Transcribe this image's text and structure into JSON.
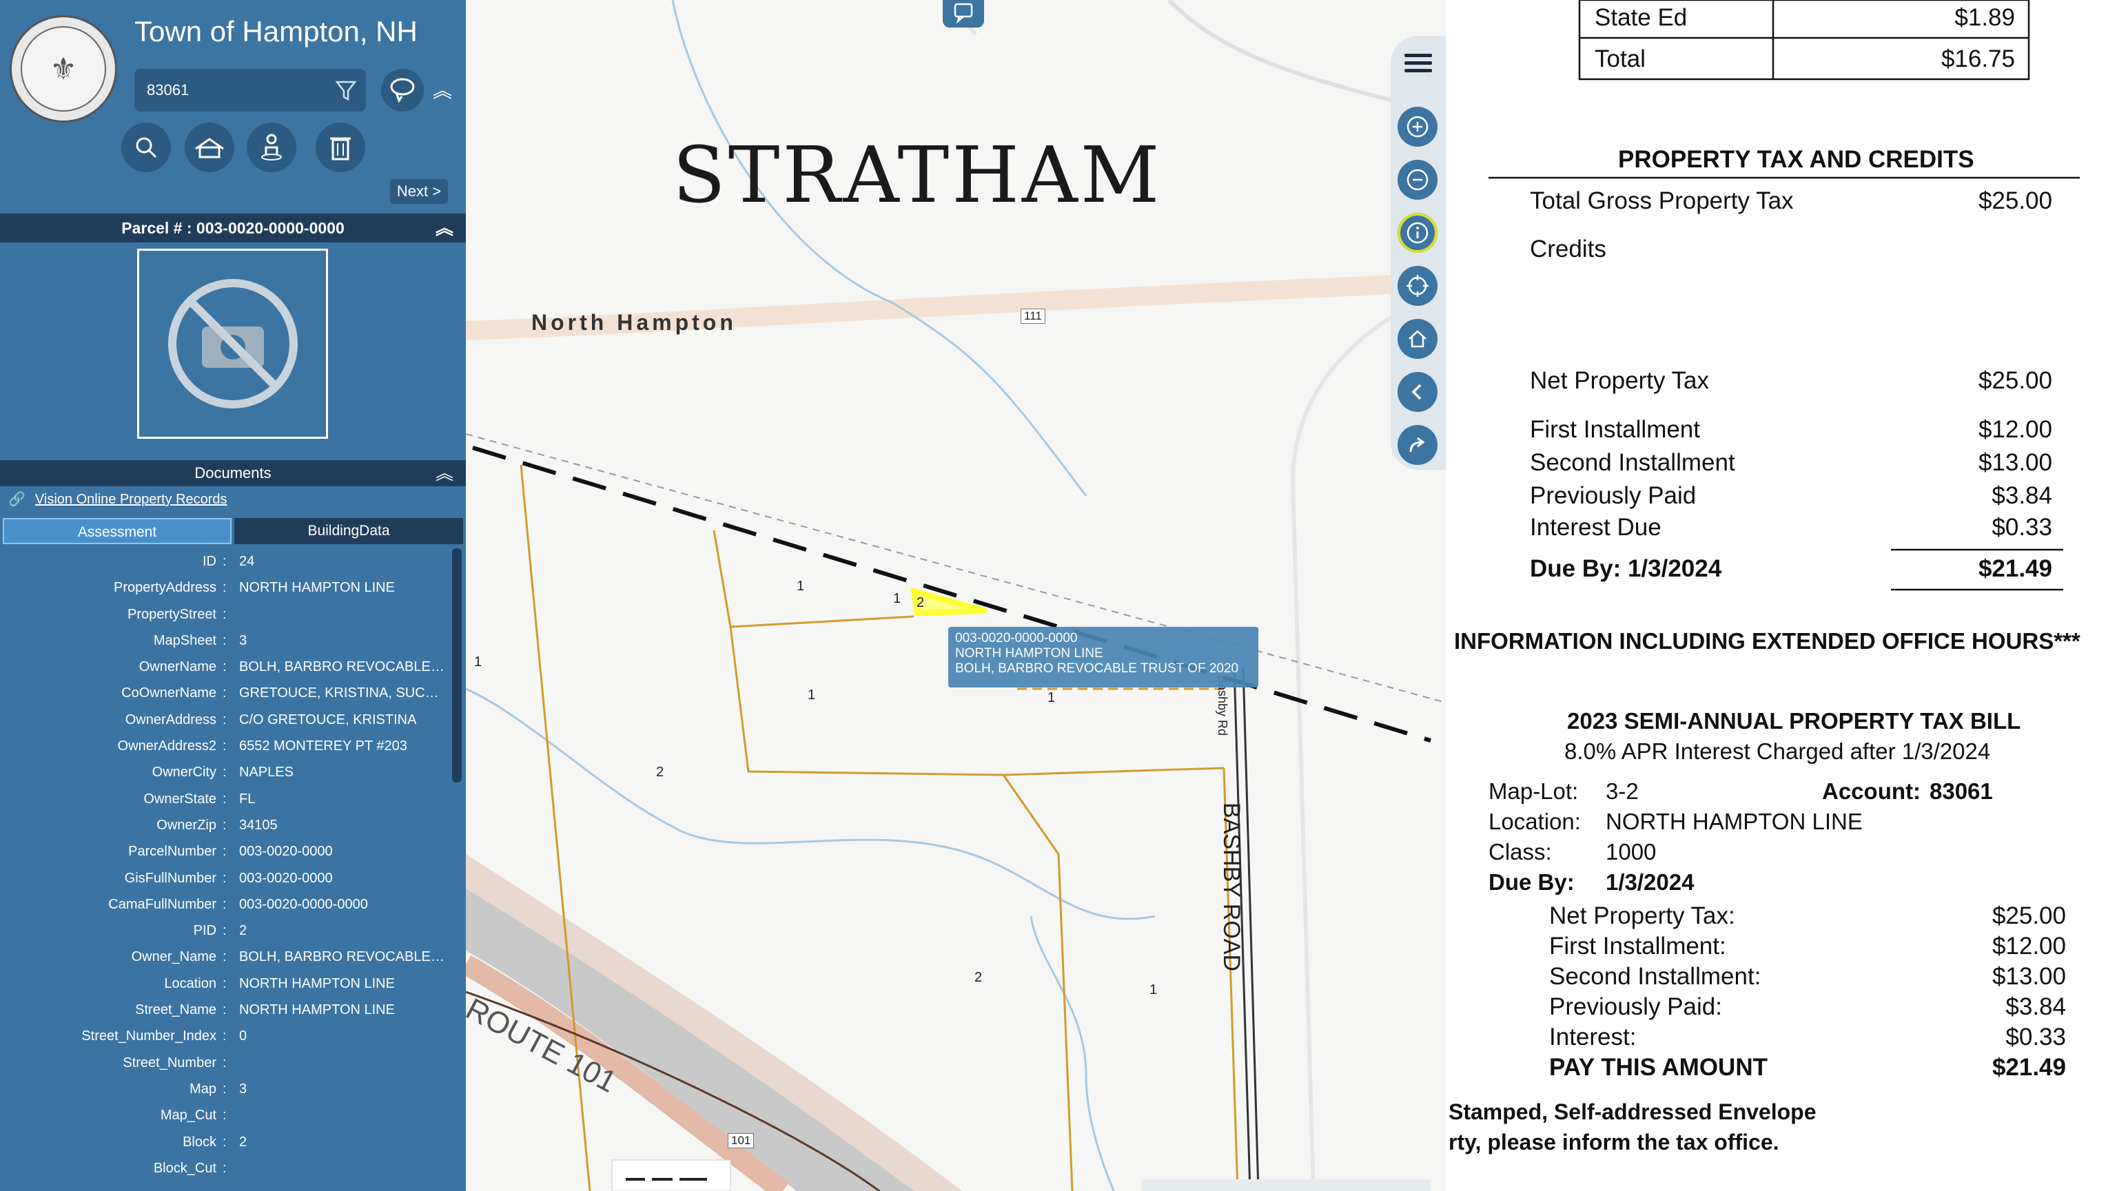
{
  "header": {
    "town_title": "Town of Hampton, NH",
    "search_value": "83061",
    "next_label": "Next >"
  },
  "parcel": {
    "title": "Parcel # : 003-0020-0000-0000"
  },
  "documents": {
    "title": "Documents",
    "link_label": "Vision Online Property Records"
  },
  "tabs": {
    "assessment": "Assessment",
    "building": "BuildingData"
  },
  "fields": [
    {
      "k": "ID",
      "v": "24"
    },
    {
      "k": "PropertyAddress",
      "v": "NORTH HAMPTON LINE"
    },
    {
      "k": "PropertyStreet",
      "v": ""
    },
    {
      "k": "MapSheet",
      "v": "3"
    },
    {
      "k": "OwnerName",
      "v": "BOLH, BARBRO REVOCABLE T..."
    },
    {
      "k": "CoOwnerName",
      "v": "GRETOUCE, KRISTINA, SUCC T..."
    },
    {
      "k": "OwnerAddress",
      "v": "C/O GRETOUCE, KRISTINA"
    },
    {
      "k": "OwnerAddress2",
      "v": "6552 MONTEREY PT #203"
    },
    {
      "k": "OwnerCity",
      "v": "NAPLES"
    },
    {
      "k": "OwnerState",
      "v": "FL"
    },
    {
      "k": "OwnerZip",
      "v": "34105"
    },
    {
      "k": "ParcelNumber",
      "v": "003-0020-0000"
    },
    {
      "k": "GisFullNumber",
      "v": "003-0020-0000"
    },
    {
      "k": "CamaFullNumber",
      "v": "003-0020-0000-0000"
    },
    {
      "k": "PID",
      "v": "2"
    },
    {
      "k": "Owner_Name",
      "v": "BOLH, BARBRO REVOCABLE T..."
    },
    {
      "k": "Location",
      "v": "NORTH HAMPTON LINE"
    },
    {
      "k": "Street_Name",
      "v": "NORTH HAMPTON LINE"
    },
    {
      "k": "Street_Number_Index",
      "v": "0"
    },
    {
      "k": "Street_Number",
      "v": ""
    },
    {
      "k": "Map",
      "v": "3"
    },
    {
      "k": "Map_Cut",
      "v": ""
    },
    {
      "k": "Block",
      "v": "2"
    },
    {
      "k": "Block_Cut",
      "v": ""
    }
  ],
  "map": {
    "town_name": "STRATHAM",
    "road_north_hampton": "North Hampton",
    "route_111_shield": "111",
    "route_101_shield": "101",
    "route_101": "ROUTE 101",
    "bashby_road": "BASHBY ROAD",
    "bashby_rd_small": "Bashby Rd",
    "popup_line1": "003-0020-0000-0000",
    "popup_line2": "NORTH HAMPTON LINE",
    "popup_line3": "BOLH, BARBRO REVOCABLE TRUST OF 2020",
    "lot_labels": [
      "1",
      "1",
      "2",
      "1",
      "1",
      "1",
      "2",
      "2",
      "1"
    ],
    "highlight_color": "#ffff33"
  },
  "bill": {
    "state_ed_label": "State Ed",
    "state_ed_value": "$1.89",
    "total_label": "Total",
    "total_value": "$16.75",
    "section_title": "PROPERTY TAX AND CREDITS",
    "gross_label": "Total Gross Property Tax",
    "gross_value": "$25.00",
    "credits_label": "Credits",
    "net_label": "Net Property Tax",
    "net_value": "$25.00",
    "first_label": "First Installment",
    "first_value": "$12.00",
    "second_label": "Second Installment",
    "second_value": "$13.00",
    "prev_label": "Previously Paid",
    "prev_value": "$3.84",
    "interest_label": "Interest Due",
    "interest_value": "$0.33",
    "due_label": "Due By:  1/3/2024",
    "due_value": "$21.49",
    "info_banner": "INFORMATION INCLUDING EXTENDED OFFICE HOURS***",
    "stub_title": "2023 SEMI-ANNUAL PROPERTY TAX BILL",
    "stub_apr": "8.0% APR Interest Charged after 1/3/2024",
    "maplot_label": "Map-Lot:",
    "maplot_value": "3-2",
    "account_label": "Account:",
    "account_value": "83061",
    "location_label": "Location:",
    "location_value": "NORTH HAMPTON LINE",
    "class_label": "Class:",
    "class_value": "1000",
    "dueby_label": "Due By:",
    "dueby_value": "1/3/2024",
    "s_net_label": "Net Property Tax:",
    "s_net_value": "$25.00",
    "s_first_label": "First Installment:",
    "s_first_value": "$12.00",
    "s_second_label": "Second Installment:",
    "s_second_value": "$13.00",
    "s_prev_label": "Previously Paid:",
    "s_prev_value": "$3.84",
    "s_interest_label": "Interest:",
    "s_interest_value": "$0.33",
    "s_pay_label": "PAY THIS AMOUNT",
    "s_pay_value": "$21.49",
    "footer1": "Stamped, Self-addressed Envelope",
    "footer2": "rty, please inform the tax office."
  }
}
